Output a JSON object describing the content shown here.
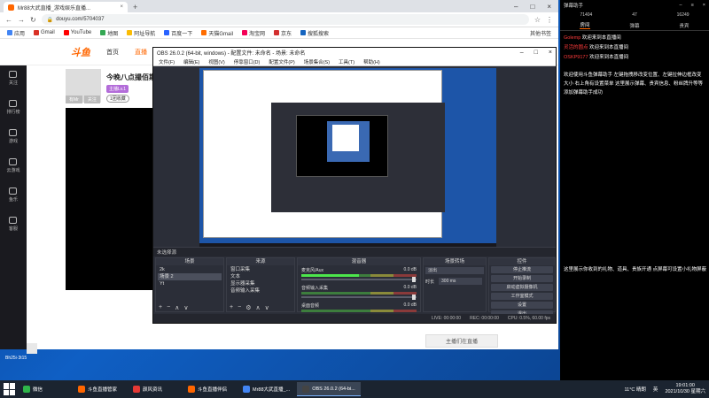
{
  "browser": {
    "tab_title": "Mr88大武直播_游戏娱乐直播...",
    "url": "douyu.com/5704037",
    "bookmarks": [
      "应用",
      "Gmail",
      "YouTube",
      "地图",
      "阿址导航",
      "百度一下",
      "天猫Gmail",
      "淘宝网",
      "京东",
      "搜狐搜索"
    ],
    "bookmarks_right": "其他书签"
  },
  "douyu": {
    "logo": "斗鱼",
    "nav": [
      "首页",
      "直播"
    ],
    "sidebar": [
      "关注",
      "排行榜",
      "游戏",
      "云游戏",
      "鱼乐",
      "客服"
    ],
    "room_title": "今晚八点撮佰斯资",
    "room_tag": "主播Lv.1",
    "room_tag2": "1团收藏",
    "room_btns": [
      "有Mr",
      "关注"
    ],
    "follow_btn": "主播们在直播"
  },
  "desktop_icon": "Bh25i·3t15",
  "obs": {
    "title": "OBS 26.0.2 (64-bit, windows) - 配置文件: 未命名 - 场景: 未命名",
    "menu": [
      "文件(F)",
      "编辑(E)",
      "视图(V)",
      "停靠窗口(D)",
      "配置文件(P)",
      "场景集合(S)",
      "工具(T)",
      "帮助(H)"
    ],
    "status_line": "未选择源",
    "docks": {
      "scenes": {
        "header": "场景",
        "items": [
          "2k",
          "场景 2",
          "Yt"
        ]
      },
      "sources": {
        "header": "来源",
        "items": [
          "窗口采集",
          "文本",
          "显示器采集",
          "音频输入采集"
        ]
      },
      "mixer": {
        "header": "混音器",
        "channels": [
          {
            "name": "麦克风/Aux",
            "db": "0.0 dB"
          },
          {
            "name": "音频输入采集",
            "db": "0.0 dB"
          },
          {
            "name": "桌面音频",
            "db": "0.0 dB"
          }
        ]
      },
      "transitions": {
        "header": "场景转场",
        "mode": "淡出",
        "duration_label": "时长",
        "duration": "300 ms"
      },
      "controls": {
        "header": "控件",
        "buttons": [
          "停止推流",
          "开始录制",
          "启动虚拟摄像机",
          "工作室模式",
          "设置",
          "退出"
        ]
      }
    },
    "statusbar": [
      "LIVE: 00:00:00",
      "REC: 00:00:00",
      "CPU: 0.5%, 60.00 fps"
    ]
  },
  "assistant": {
    "title": "弹幕助手",
    "stats": [
      "71404",
      "47",
      "16249"
    ],
    "tabs": [
      "房间",
      "弹幕",
      "贵宾"
    ],
    "welcome": [
      {
        "user": "Golemp",
        "text": "欢迎来到本直播间"
      },
      {
        "user": "灵活的圆点",
        "text": "欢迎来到本直播间"
      },
      {
        "user": "OSKP9177",
        "text": "欢迎来到本直播间"
      }
    ],
    "message1": "欢迎使用斗鱼弹幕助手 左键拖拽移改变位置、左键拉伸边框改变大小 右上角有设置菜单 这里展示弹幕、贵宾信息、粉丝牌升等等 添加弹幕助手成功",
    "message2": "这里展示你收到的礼物、道具、贵族开通 点屏幕可设置小礼物屏蔽"
  },
  "taskbar": {
    "items": [
      "微信",
      "斗鱼直播管家",
      "颜风资讯",
      "斗鱼直播伴侣",
      "Mr88大武直播_...",
      "OBS 26.0.2 (64-bi..."
    ],
    "active_index": 5,
    "weather": "11°C 晴朗",
    "lang": "英",
    "time": "19:01:00",
    "date": "2021/10/30 星期六"
  }
}
